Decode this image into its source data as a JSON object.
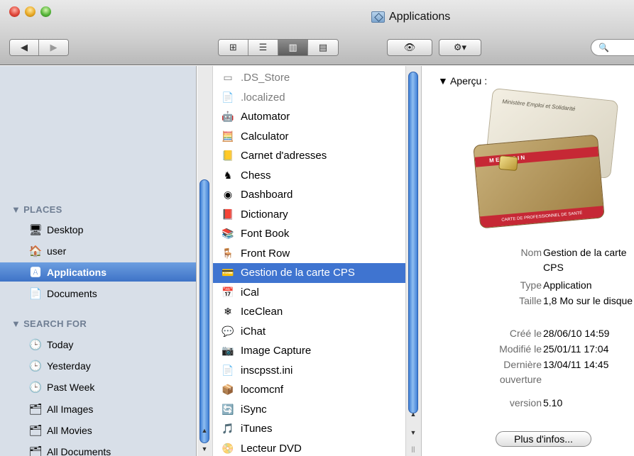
{
  "window": {
    "title": "Applications"
  },
  "toolbar": {
    "back_glyph": "◀",
    "forward_glyph": "▶",
    "view_modes": [
      "⊞",
      "☰",
      "▥",
      "▤"
    ],
    "quicklook_glyph": "👁",
    "action_glyph": "⚙▾",
    "search_glyph": "🔍"
  },
  "sidebar": {
    "places_label": "▼ PLACES",
    "search_label": "▼ SEARCH FOR",
    "places": [
      {
        "label": "Desktop",
        "icon": "🖥"
      },
      {
        "label": "user",
        "icon": "🏠"
      },
      {
        "label": "Applications",
        "icon": "🅰"
      },
      {
        "label": "Documents",
        "icon": "📄"
      }
    ],
    "search": [
      {
        "label": "Today",
        "icon": "🕒"
      },
      {
        "label": "Yesterday",
        "icon": "🕒"
      },
      {
        "label": "Past Week",
        "icon": "🕒"
      },
      {
        "label": "All Images",
        "icon": "🗂"
      },
      {
        "label": "All Movies",
        "icon": "🗂"
      },
      {
        "label": "All Documents",
        "icon": "🗂"
      }
    ]
  },
  "files": [
    {
      "name": ".DS_Store",
      "icon": "▭"
    },
    {
      "name": ".localized",
      "icon": "📄"
    },
    {
      "name": "Automator",
      "icon": "🤖"
    },
    {
      "name": "Calculator",
      "icon": "🧮"
    },
    {
      "name": "Carnet d'adresses",
      "icon": "📒"
    },
    {
      "name": "Chess",
      "icon": "♞"
    },
    {
      "name": "Dashboard",
      "icon": "◉"
    },
    {
      "name": "Dictionary",
      "icon": "📕"
    },
    {
      "name": "Font Book",
      "icon": "📚"
    },
    {
      "name": "Front Row",
      "icon": "🪑"
    },
    {
      "name": "Gestion de la carte CPS",
      "icon": "💳"
    },
    {
      "name": "iCal",
      "icon": "📅"
    },
    {
      "name": "IceClean",
      "icon": "❄"
    },
    {
      "name": "iChat",
      "icon": "💬"
    },
    {
      "name": "Image Capture",
      "icon": "📷"
    },
    {
      "name": "inscpsst.ini",
      "icon": "📄"
    },
    {
      "name": "locomcnf",
      "icon": "📦"
    },
    {
      "name": "iSync",
      "icon": "🔄"
    },
    {
      "name": "iTunes",
      "icon": "🎵"
    },
    {
      "name": "Lecteur DVD",
      "icon": "📀"
    }
  ],
  "preview": {
    "heading": "▼ Aperçu :",
    "card_top_text": "Ministère Emploi et Solidarité",
    "card_band_text": "M  E  D  E  C  I  N",
    "card_foot_text": "CARTE DE PROFESSIONNEL DE SANTÉ",
    "info": [
      {
        "key": "Nom",
        "value": "Gestion de la carte CPS"
      },
      {
        "key": "Type",
        "value": "Application"
      },
      {
        "key": "Taille",
        "value": "1,8 Mo sur le disque"
      },
      {
        "key": "Créé le",
        "value": "28/06/10 14:59"
      },
      {
        "key": "Modifié le",
        "value": "25/01/11 17:04"
      },
      {
        "key": "Dernière ouverture",
        "value": "13/04/11 14:45"
      },
      {
        "key": "version",
        "value": "5.10"
      }
    ],
    "more_label": "Plus d'infos..."
  }
}
